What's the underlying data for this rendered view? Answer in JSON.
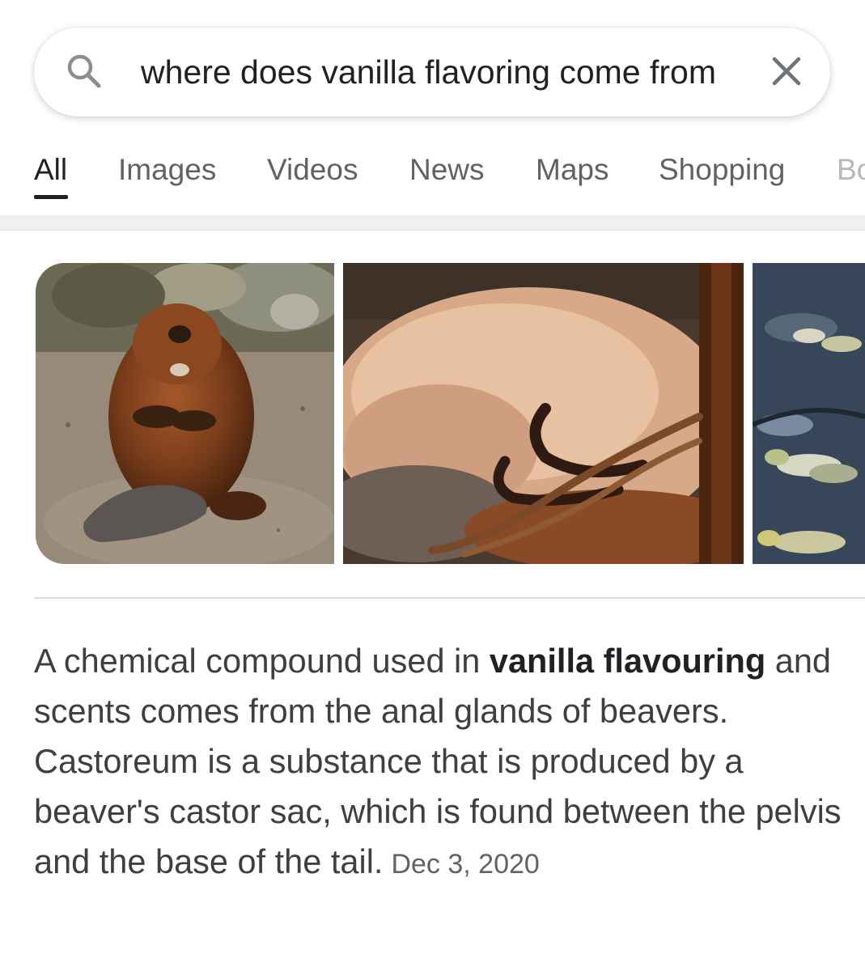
{
  "search": {
    "query": "where does vanilla flavoring come from",
    "search_icon": "search-icon",
    "clear_icon": "close-icon"
  },
  "tabs": [
    {
      "label": "All",
      "active": true
    },
    {
      "label": "Images"
    },
    {
      "label": "Videos"
    },
    {
      "label": "News"
    },
    {
      "label": "Maps"
    },
    {
      "label": "Shopping"
    },
    {
      "label": "Bo"
    }
  ],
  "images": [
    {
      "depicts": "beaver-sitting"
    },
    {
      "depicts": "beaver-castor-sac-sawdust"
    },
    {
      "depicts": "water-leaves"
    }
  ],
  "snippet": {
    "part1": "A chemical compound used in ",
    "bold1": "vanilla flavouring",
    "part2": " and scents comes from the anal glands of beavers. Castoreum is a substance that is produced by a beaver's castor sac, which is found between the pelvis and the base of the tail.",
    "date": "Dec 3, 2020"
  },
  "colors": {
    "text_primary": "#202124",
    "text_secondary": "#5f6368",
    "snippet_text": "#3c4043",
    "divider": "#dadce0"
  }
}
